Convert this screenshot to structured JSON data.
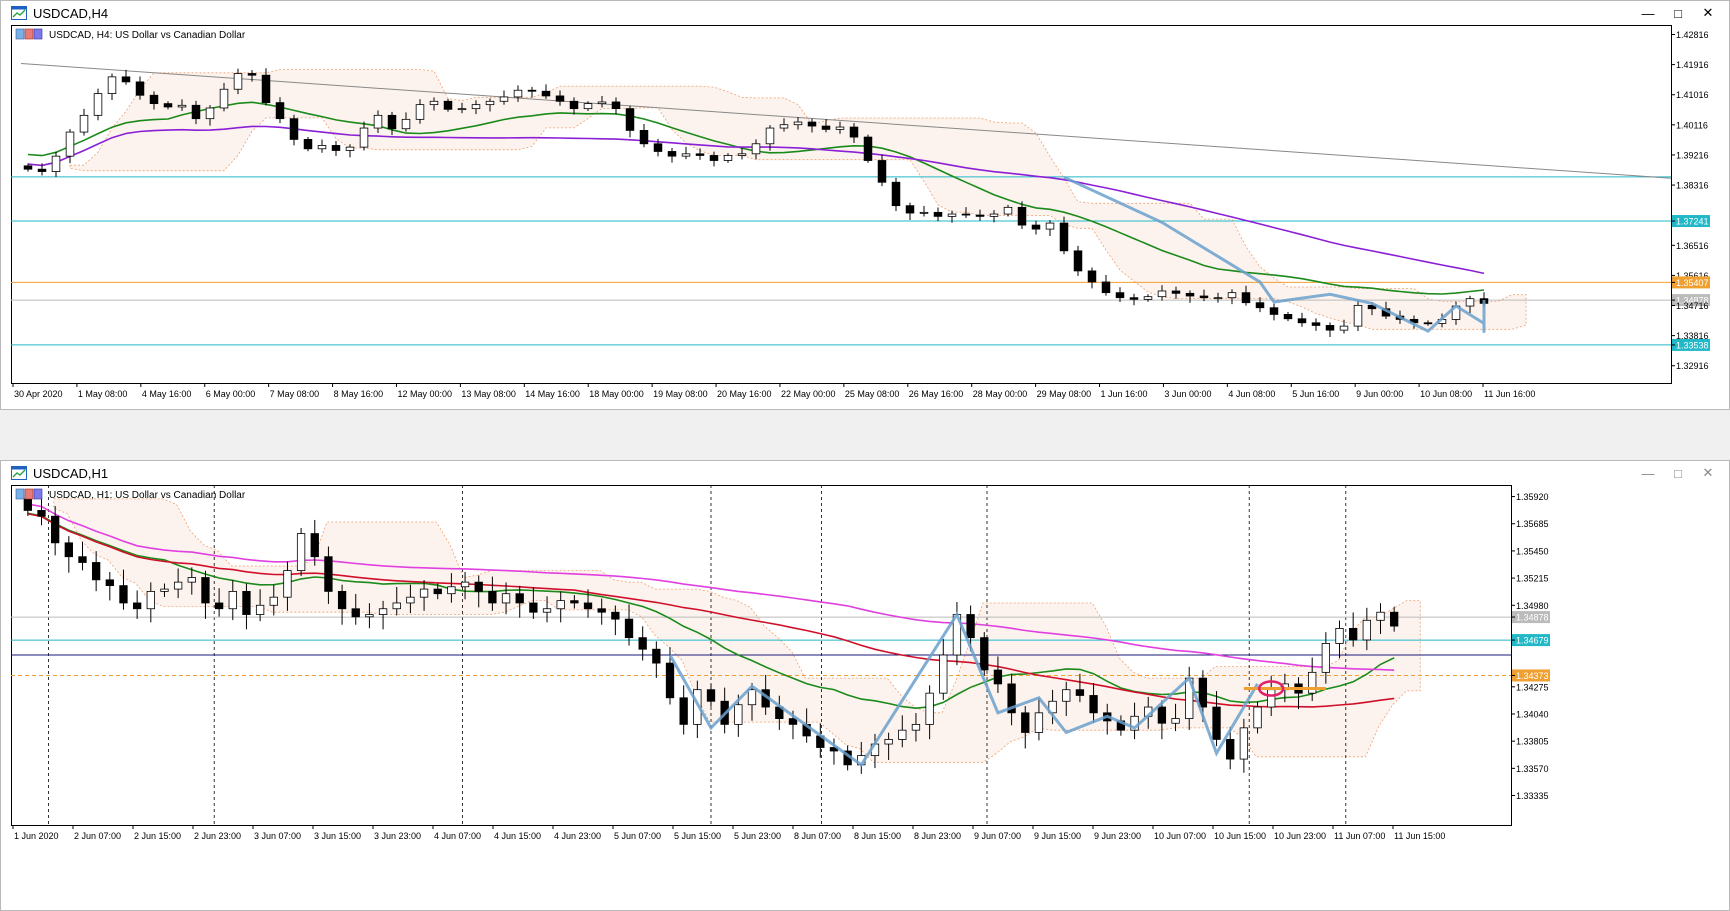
{
  "window1": {
    "title": "USDCAD,H4",
    "header": "USDCAD, H4:  US Dollar vs Canadian Dollar",
    "price_labels": [
      "1.42816",
      "1.41916",
      "1.41016",
      "1.40116",
      "1.39216",
      "1.38316",
      "1.37241",
      "1.36516",
      "1.35616",
      "1.35407",
      "1.34878",
      "1.34716",
      "1.33816",
      "1.33538",
      "1.32916"
    ],
    "time_labels": [
      "30 Apr 2020",
      "1 May 08:00",
      "4 May 16:00",
      "6 May 00:00",
      "7 May 08:00",
      "8 May 16:00",
      "12 May 00:00",
      "13 May 08:00",
      "14 May 16:00",
      "18 May 00:00",
      "19 May 08:00",
      "20 May 16:00",
      "22 May 00:00",
      "25 May 08:00",
      "26 May 16:00",
      "28 May 00:00",
      "29 May 08:00",
      "1 Jun 16:00",
      "3 Jun 00:00",
      "4 Jun 08:00",
      "5 Jun 16:00",
      "9 Jun 00:00",
      "10 Jun 08:00",
      "11 Jun 16:00"
    ]
  },
  "window2": {
    "title": "USDCAD,H1",
    "header": "USDCAD, H1:  US Dollar vs Canadian Dollar",
    "price_labels": [
      "1.35920",
      "1.35685",
      "1.35450",
      "1.35215",
      "1.34980",
      "1.34878",
      "1.34679",
      "1.34373",
      "1.34275",
      "1.34040",
      "1.33805",
      "1.33570",
      "1.33335"
    ],
    "time_labels": [
      "1 Jun 2020",
      "2 Jun 07:00",
      "2 Jun 15:00",
      "2 Jun 23:00",
      "3 Jun 07:00",
      "3 Jun 15:00",
      "3 Jun 23:00",
      "4 Jun 07:00",
      "4 Jun 15:00",
      "4 Jun 23:00",
      "5 Jun 07:00",
      "5 Jun 15:00",
      "5 Jun 23:00",
      "8 Jun 07:00",
      "8 Jun 15:00",
      "8 Jun 23:00",
      "9 Jun 07:00",
      "9 Jun 15:00",
      "9 Jun 23:00",
      "10 Jun 07:00",
      "10 Jun 15:00",
      "10 Jun 23:00",
      "11 Jun 07:00",
      "11 Jun 15:00"
    ]
  },
  "colors": {
    "ma_green": "#1a8a1a",
    "ma_purple": "#8b1fd6",
    "ma_red": "#d0102a",
    "ma_magenta": "#e040e0",
    "cloud": "#f0a070",
    "pattern": "#6aa0cc",
    "hline_cyan": "#22b8c8",
    "hline_orange": "#f0a030",
    "hline_navy": "#1a1a7a"
  },
  "chart_data": [
    {
      "type": "candlestick",
      "symbol": "USDCAD",
      "timeframe": "H4",
      "ylim": [
        1.324,
        1.431
      ],
      "close_series": [
        1.3879,
        1.3872,
        1.3918,
        1.399,
        1.404,
        1.4105,
        1.4155,
        1.414,
        1.41,
        1.4075,
        1.4065,
        1.407,
        1.403,
        1.4062,
        1.4118,
        1.4165,
        1.416,
        1.4078,
        1.403,
        1.3968,
        1.394,
        1.395,
        1.3935,
        1.3945,
        1.4002,
        1.404,
        1.4,
        1.4028,
        1.4072,
        1.4082,
        1.4058,
        1.406,
        1.4072,
        1.4082,
        1.4095,
        1.4115,
        1.4112,
        1.4098,
        1.4082,
        1.406,
        1.4075,
        1.408,
        1.406,
        1.3995,
        1.3955,
        1.3932,
        1.3918,
        1.3925,
        1.392,
        1.3905,
        1.392,
        1.3925,
        1.3955,
        1.4002,
        1.4012,
        1.402,
        1.4008,
        1.3998,
        1.4005,
        1.3975,
        1.3905,
        1.384,
        1.377,
        1.3748,
        1.375,
        1.3738,
        1.3745,
        1.3742,
        1.3738,
        1.3745,
        1.3765,
        1.3712,
        1.37,
        1.3718,
        1.3635,
        1.3575,
        1.3542,
        1.351,
        1.3495,
        1.349,
        1.3498,
        1.3515,
        1.3508,
        1.35,
        1.3495,
        1.3495,
        1.351,
        1.348,
        1.3465,
        1.3445,
        1.3432,
        1.342,
        1.3412,
        1.3398,
        1.341,
        1.3472,
        1.3462,
        1.344,
        1.343,
        1.342,
        1.3418,
        1.343,
        1.347,
        1.3492,
        1.3478
      ],
      "series": [
        {
          "name": "",
          "kind": "sma",
          "values_start": 1.4055,
          "values_end": 1.373
        },
        {
          "name": "",
          "kind": "sma",
          "values_start": 1.394,
          "values_end": 1.3425
        }
      ],
      "hlines": [
        1.3856,
        1.37241,
        1.35407,
        1.34878,
        1.33538
      ]
    },
    {
      "type": "candlestick",
      "symbol": "USDCAD",
      "timeframe": "H1",
      "ylim": [
        1.3308,
        1.3602
      ],
      "close_series": [
        1.358,
        1.3575,
        1.3552,
        1.354,
        1.3535,
        1.352,
        1.3515,
        1.35,
        1.3495,
        1.351,
        1.3512,
        1.3518,
        1.3522,
        1.35,
        1.3495,
        1.351,
        1.349,
        1.3498,
        1.3505,
        1.3528,
        1.356,
        1.354,
        1.351,
        1.3495,
        1.3488,
        1.349,
        1.3495,
        1.35,
        1.3505,
        1.3512,
        1.3508,
        1.3514,
        1.3518,
        1.351,
        1.35,
        1.3508,
        1.35,
        1.3492,
        1.3495,
        1.3502,
        1.35,
        1.3495,
        1.3492,
        1.3486,
        1.347,
        1.346,
        1.3448,
        1.3418,
        1.3395,
        1.3425,
        1.3415,
        1.3395,
        1.3412,
        1.3425,
        1.341,
        1.34,
        1.3395,
        1.3385,
        1.3375,
        1.3372,
        1.336,
        1.3368,
        1.3378,
        1.3382,
        1.339,
        1.3395,
        1.3422,
        1.3455,
        1.349,
        1.347,
        1.3442,
        1.343,
        1.3405,
        1.3388,
        1.3405,
        1.3415,
        1.3425,
        1.342,
        1.3405,
        1.3398,
        1.339,
        1.3402,
        1.341,
        1.3396,
        1.34,
        1.3435,
        1.341,
        1.3382,
        1.3365,
        1.3392,
        1.341,
        1.3425,
        1.343,
        1.3422,
        1.344,
        1.3465,
        1.3478,
        1.3468,
        1.3485,
        1.3492,
        1.348
      ],
      "series": [
        {
          "name": "",
          "kind": "sma",
          "values_start": 1.357,
          "values_end": 1.3448
        },
        {
          "name": "",
          "kind": "sma",
          "values_start": 1.3568,
          "values_end": 1.341
        },
        {
          "name": "",
          "kind": "sma",
          "values_start": 1.3602,
          "values_end": 1.3499
        }
      ],
      "hlines": [
        1.34878,
        1.34679,
        1.3455,
        1.34373
      ]
    }
  ]
}
